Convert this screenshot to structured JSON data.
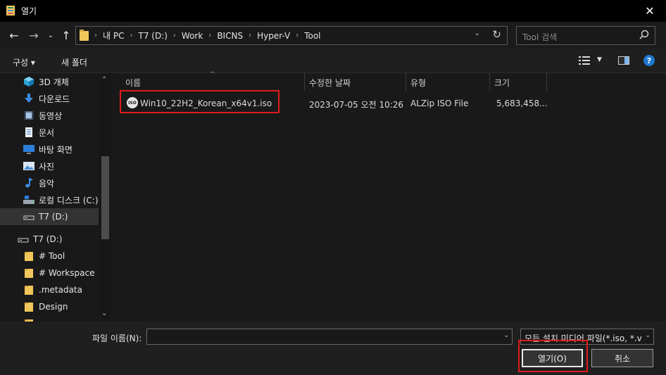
{
  "window": {
    "title": "열기"
  },
  "address": {
    "crumbs": [
      "내 PC",
      "T7 (D:)",
      "Work",
      "BICNS",
      "Hyper-V",
      "Tool"
    ]
  },
  "search": {
    "placeholder": "Tool 검색"
  },
  "toolbar": {
    "organize": "구성 ▾",
    "new_folder": "새 폴더"
  },
  "sidebar": {
    "items": [
      {
        "label": "3D 개체",
        "icon": "cube-3d-icon"
      },
      {
        "label": "다운로드",
        "icon": "download-icon"
      },
      {
        "label": "동영상",
        "icon": "video-icon"
      },
      {
        "label": "문서",
        "icon": "document-icon"
      },
      {
        "label": "바탕 화면",
        "icon": "desktop-icon"
      },
      {
        "label": "사진",
        "icon": "picture-icon"
      },
      {
        "label": "음악",
        "icon": "music-icon"
      },
      {
        "label": "로컬 디스크 (C:)",
        "icon": "local-disk-icon"
      },
      {
        "label": "T7 (D:)",
        "icon": "drive-icon",
        "selected": true
      },
      {
        "label": "T7 (D:)",
        "icon": "drive-icon"
      },
      {
        "label": "# Tool",
        "icon": "folder-icon"
      },
      {
        "label": "# Workspace",
        "icon": "folder-icon"
      },
      {
        "label": ".metadata",
        "icon": "folder-icon"
      },
      {
        "label": "Design",
        "icon": "folder-icon"
      }
    ]
  },
  "columns": {
    "name": "이름",
    "modified": "수정한 날짜",
    "type": "유형",
    "size": "크기"
  },
  "files": [
    {
      "name": "Win10_22H2_Korean_x64v1.iso",
      "modified": "2023-07-05 오전 10:26",
      "type": "ALZip ISO File",
      "size": "5,683,458...",
      "icon_text": "ISO"
    }
  ],
  "bottom": {
    "filename_label": "파일 이름(N):",
    "filename_value": "",
    "filter_value": "모든 설치 미디어 파일(*.iso, *.v",
    "open_label": "열기(O)",
    "cancel_label": "취소"
  },
  "colors": {
    "highlight": "#e01c1c",
    "folder": "#f1c75b",
    "help": "#1f78d1"
  }
}
